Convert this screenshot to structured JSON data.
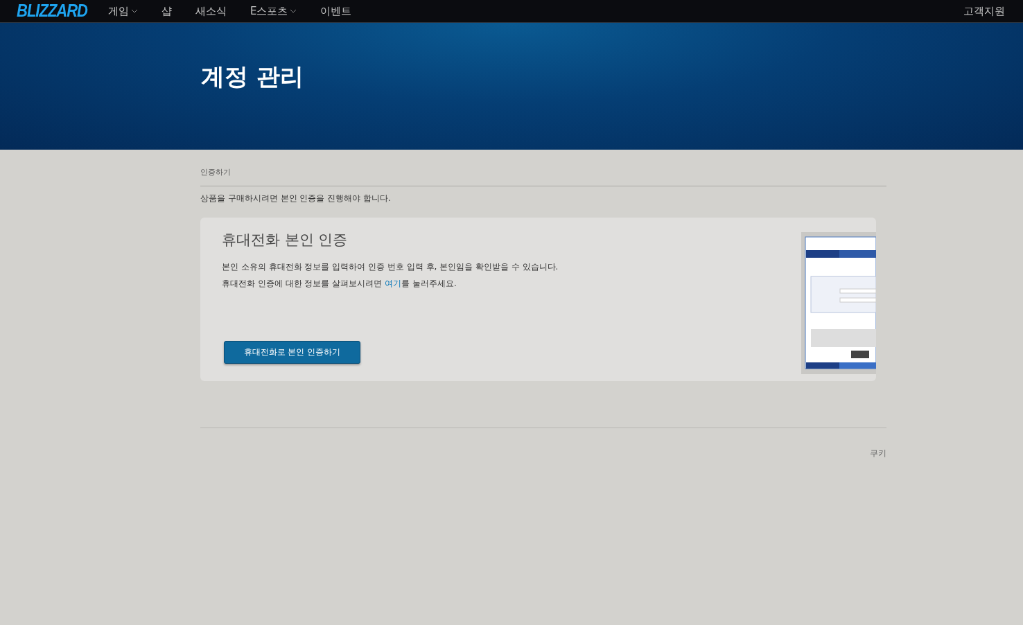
{
  "nav": {
    "logo": "BLIZZARD",
    "items": [
      {
        "label": "게임",
        "dropdown": true
      },
      {
        "label": "샵",
        "dropdown": false
      },
      {
        "label": "새소식",
        "dropdown": false
      },
      {
        "label": "E스포츠",
        "dropdown": true
      },
      {
        "label": "이벤트",
        "dropdown": false
      }
    ],
    "support": "고객지원"
  },
  "hero": {
    "title": "계정 관리"
  },
  "breadcrumb": "인증하기",
  "notice": "상품을 구매하시려면 본인 인증을 진행해야 합니다.",
  "card": {
    "title": "휴대전화 본인 인증",
    "line1": "본인 소유의 휴대전화 정보를 입력하여 인증 번호 입력 후, 본인임을 확인받을 수 있습니다.",
    "line2": {
      "before": "휴대전화 인증에 대한 정보를 살펴보시려면 ",
      "link": "여기",
      "after": "를 눌러주세요."
    },
    "button": "휴대전화로 본인 인증하기"
  },
  "footer": {
    "link": "쿠키"
  }
}
